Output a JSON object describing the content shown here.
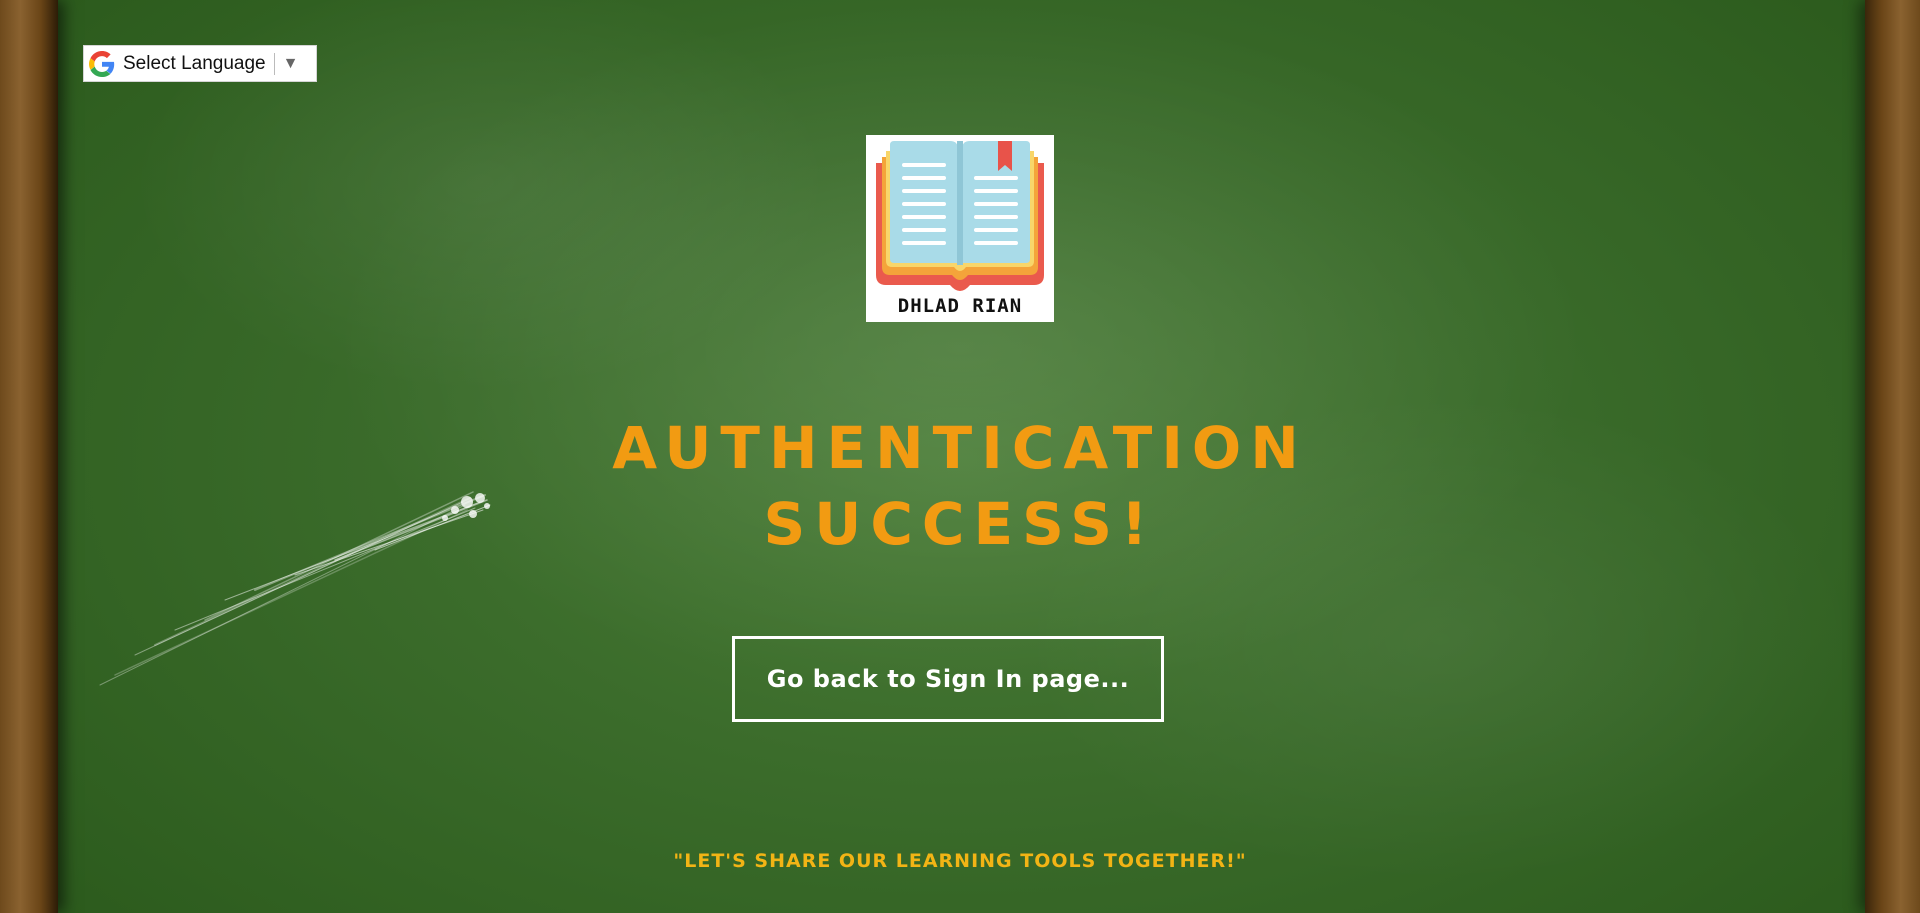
{
  "language_widget": {
    "label": "Select Language",
    "caret": "▼",
    "icon": "google-g-icon"
  },
  "logo": {
    "icon": "open-book-icon",
    "brand_text": "DHLAD RIAN"
  },
  "main": {
    "title_line1": "AUTHENTICATION",
    "title_line2": "SUCCESS!",
    "button_label": "Go back to Sign In page...",
    "tagline": "\"LET'S SHARE OUR LEARNING TOOLS TOGETHER!\""
  },
  "colors": {
    "board_green": "#3b6c2b",
    "title_orange": "#f29b12",
    "tagline_yellow": "#f2b415",
    "frame_wood": "#8a6230"
  }
}
